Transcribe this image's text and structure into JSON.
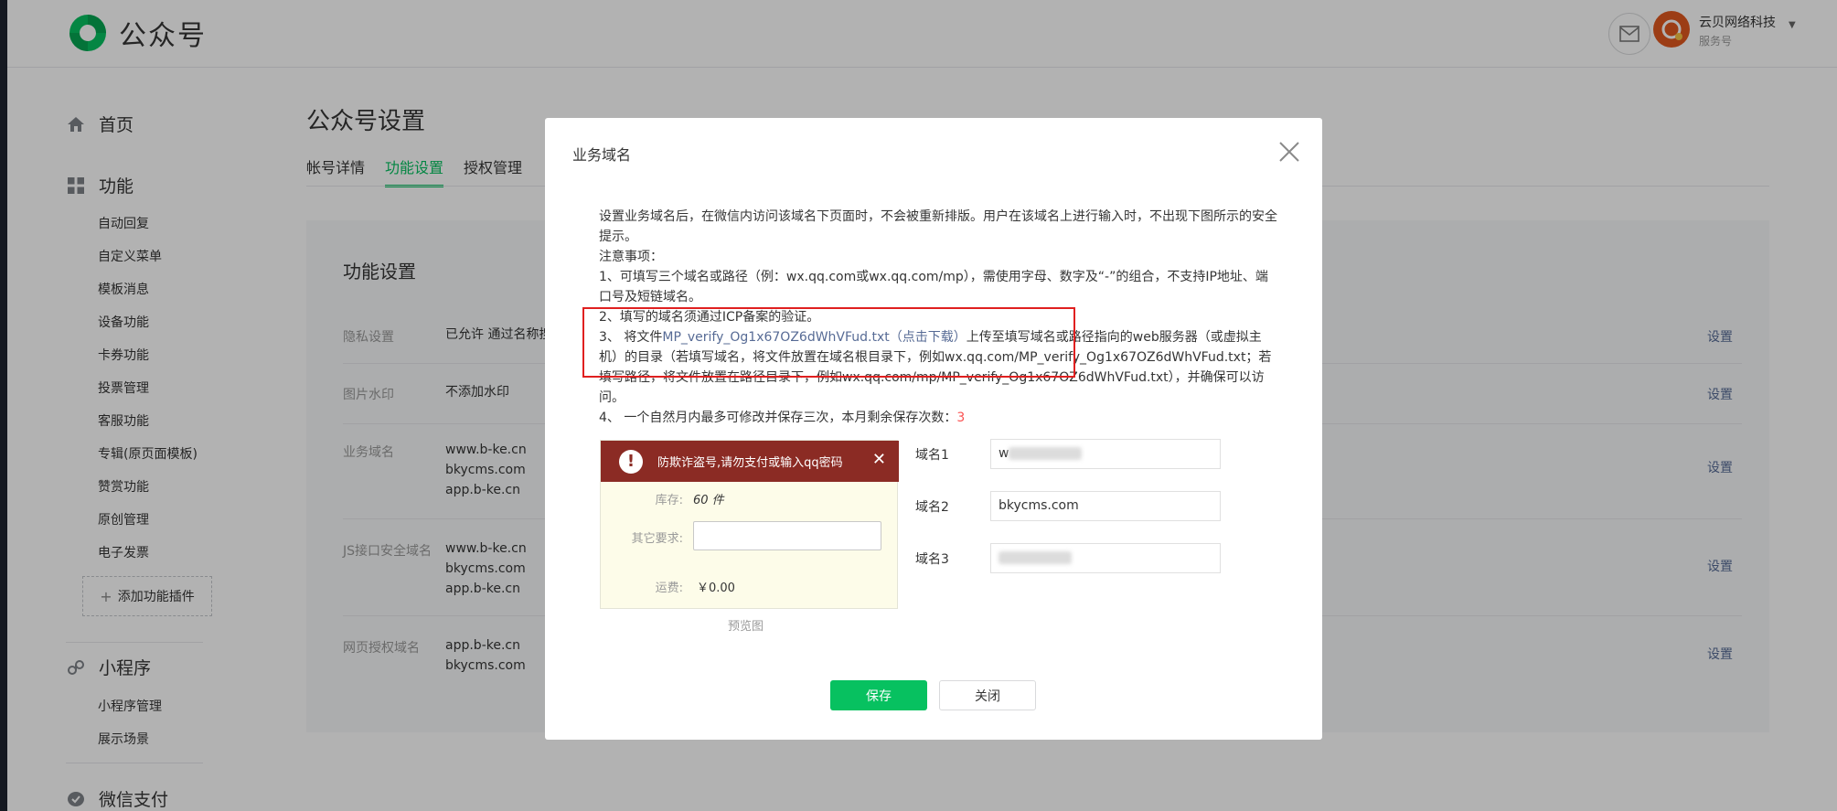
{
  "header": {
    "app_title": "公众号",
    "account_name": "云贝网络科技",
    "account_type": "服务号"
  },
  "sidebar": {
    "groups": [
      {
        "label": "首页"
      },
      {
        "label": "功能"
      },
      {
        "label": "小程序"
      },
      {
        "label": "微信支付"
      }
    ],
    "function_items": [
      "自动回复",
      "自定义菜单",
      "模板消息",
      "设备功能",
      "卡券功能",
      "投票管理",
      "客服功能",
      "专辑(原页面模板)",
      "赞赏功能",
      "原创管理",
      "电子发票"
    ],
    "add_plugin": "添加功能插件",
    "mini_items": [
      "小程序管理",
      "展示场景"
    ]
  },
  "page": {
    "title": "公众号设置",
    "tabs": [
      "帐号详情",
      "功能设置",
      "授权管理"
    ],
    "panel_title": "功能设置",
    "rows": [
      {
        "label": "隐私设置",
        "value": [
          "已允许 通过名称搜"
        ],
        "action": "设置"
      },
      {
        "label": "图片水印",
        "value": [
          "不添加水印"
        ],
        "action": "设置"
      },
      {
        "label": "业务域名",
        "value": [
          "www.b-ke.cn",
          "bkycms.com",
          "app.b-ke.cn"
        ],
        "action": "设置"
      },
      {
        "label": "JS接口安全域名",
        "value": [
          "www.b-ke.cn",
          "bkycms.com",
          "app.b-ke.cn"
        ],
        "action": "设置"
      },
      {
        "label": "网页授权域名",
        "value": [
          "app.b-ke.cn",
          "bkycms.com"
        ],
        "action": "设置"
      }
    ]
  },
  "dialog": {
    "title": "业务域名",
    "intro": "设置业务域名后，在微信内访问该域名下页面时，不会被重新排版。用户在该域名上进行输入时，不出现下图所示的安全提示。",
    "notes_title": "注意事项：",
    "note1": "1、可填写三个域名或路径（例：wx.qq.com或wx.qq.com/mp），需使用字母、数字及“-”的组合，不支持IP地址、端口号及短链域名。",
    "note2": "2、填写的域名须通过ICP备案的验证。",
    "note3_prefix": "3、 将文件",
    "note3_file": "MP_verify_Og1x67OZ6dWhVFud.txt（点击下载）",
    "note3_suffix": "上传至填写域名或路径指向的web服务器（或虚拟主机）的目录（若填写域名，将文件放置在域名根目录下，例如wx.qq.com/MP_verify_Og1x67OZ6dWhVFud.txt；若填写路径，将文件放置在路径目录下，例如wx.qq.com/mp/MP_verify_Og1x67OZ6dWhVFud.txt），并确保可以访问。",
    "note4_prefix": "4、 一个自然月内最多可修改并保存三次，本月剩余保存次数：",
    "note4_count": "3",
    "preview": {
      "warning": "防欺诈盗号,请勿支付或输入qq密码",
      "stock_label": "库存:",
      "stock_value": "60 件",
      "other_label": "其它要求:",
      "shipping_label": "运费:",
      "shipping_value": "￥0.00",
      "caption": "预览图"
    },
    "domains": [
      {
        "label": "域名1",
        "value": "w"
      },
      {
        "label": "域名2",
        "value": "bkycms.com"
      },
      {
        "label": "域名3",
        "value": ""
      }
    ],
    "save_label": "保存",
    "close_label": "关闭"
  }
}
